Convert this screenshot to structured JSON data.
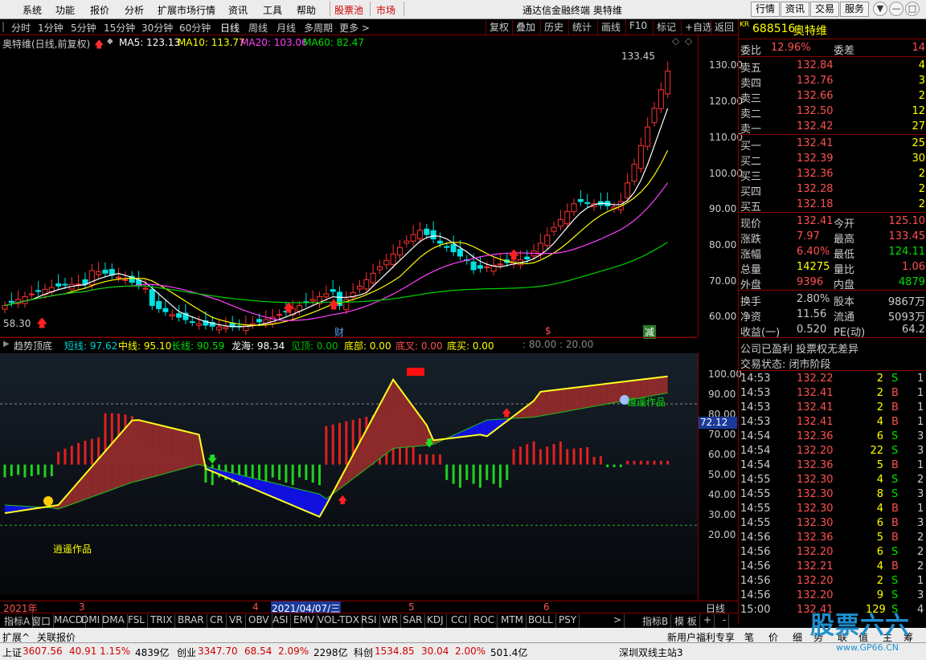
{
  "menubar": {
    "items": [
      "系统",
      "功能",
      "报价",
      "分析",
      "扩展市场行情",
      "资讯",
      "工具",
      "帮助",
      "股票池",
      "市场"
    ],
    "title": "通达信金融终端  奥特维",
    "right_buttons": [
      "行情",
      "资讯",
      "交易",
      "服务"
    ],
    "win_icons": [
      "▼",
      "—",
      "□",
      "✕"
    ]
  },
  "period": {
    "items": [
      "分时",
      "1分钟",
      "5分钟",
      "15分钟",
      "30分钟",
      "60分钟",
      "日线",
      "周线",
      "月线",
      "多周期",
      "更多 >"
    ],
    "active": "日线",
    "tools": [
      "复权",
      "叠加",
      "历史",
      "统计",
      "画线",
      "F10",
      "标记",
      "+自选",
      "返回"
    ]
  },
  "info": {
    "name": "奥特维(日线,前复权)",
    "ma5": "MA5: 123.13",
    "ma10": "MA10: 113.77",
    "ma20": "MA20: 103.06",
    "ma60": "MA60: 82.47",
    "high_label": "133.45",
    "low_label": "58.30"
  },
  "price_axis": [
    "130.00",
    "120.00",
    "110.00",
    "100.00",
    "90.00",
    "80.00",
    "70.00",
    "60.00"
  ],
  "markers": [
    "财",
    "$",
    "减"
  ],
  "indicator": {
    "name": "趋势顶底",
    "short": "短线: 97.62",
    "mid": "中线: 95.10",
    "long": "长线: 90.59",
    "longhai": "龙海: 98.34",
    "jd": "见顶: 0.00",
    "db": "底部: 0.00",
    "dc": "底叉: 0.00",
    "dm": "底买: 0.00",
    "lv": ": 80.00 : 20.00",
    "badge": "72.12",
    "axis": [
      "100.00",
      "90.00",
      "80.00",
      "70.00",
      "60.00",
      "50.00",
      "40.00",
      "30.00",
      "20.00"
    ],
    "wm1": "逍遥作品",
    "wm2": "逍遥作品"
  },
  "dates": {
    "year": "2021年",
    "m3": "3",
    "m4": "4",
    "sel": "2021/04/07/三",
    "m5": "5",
    "m6": "6",
    "period": "日线"
  },
  "quote": {
    "stock_code": "688516",
    "stock_name": "奥特维",
    "kr": "KR",
    "weibi_label": "委比",
    "weibi": "12.96%",
    "weicha_label": "委差",
    "weicha": "14",
    "asks": [
      {
        "l": "卖五",
        "p": "132.84",
        "v": "4"
      },
      {
        "l": "卖四",
        "p": "132.76",
        "v": "3"
      },
      {
        "l": "卖三",
        "p": "132.66",
        "v": "2"
      },
      {
        "l": "卖二",
        "p": "132.50",
        "v": "12"
      },
      {
        "l": "卖一",
        "p": "132.42",
        "v": "27"
      }
    ],
    "bids": [
      {
        "l": "买一",
        "p": "132.41",
        "v": "25"
      },
      {
        "l": "买二",
        "p": "132.39",
        "v": "30"
      },
      {
        "l": "买三",
        "p": "132.36",
        "v": "2"
      },
      {
        "l": "买四",
        "p": "132.28",
        "v": "2"
      },
      {
        "l": "买五",
        "p": "132.18",
        "v": "2"
      }
    ],
    "stats": [
      [
        "现价",
        "132.41",
        "今开",
        "125.10"
      ],
      [
        "涨跌",
        "7.97",
        "最高",
        "133.45"
      ],
      [
        "涨幅",
        "6.40%",
        "最低",
        "124.11"
      ],
      [
        "总量",
        "14275",
        "量比",
        "1.06"
      ],
      [
        "外盘",
        "9396",
        "内盘",
        "4879"
      ]
    ],
    "stats2": [
      [
        "换手",
        "2.80%",
        "股本",
        "9867万"
      ],
      [
        "净资",
        "11.56",
        "流通",
        "5093万"
      ],
      [
        "收益(一)",
        "0.520",
        "PE(动)",
        "64.2"
      ]
    ],
    "note1": "公司已盈利 投票权无差异",
    "note2": "交易状态: 闭市阶段",
    "ticks": [
      [
        "14:53",
        "132.22",
        "2",
        "S",
        "1"
      ],
      [
        "14:53",
        "132.41",
        "2",
        "B",
        "1"
      ],
      [
        "14:53",
        "132.41",
        "2",
        "B",
        "1"
      ],
      [
        "14:53",
        "132.41",
        "4",
        "B",
        "1"
      ],
      [
        "14:54",
        "132.36",
        "6",
        "S",
        "3"
      ],
      [
        "14:54",
        "132.20",
        "22",
        "S",
        "3"
      ],
      [
        "14:54",
        "132.36",
        "5",
        "B",
        "1"
      ],
      [
        "14:55",
        "132.30",
        "4",
        "S",
        "2"
      ],
      [
        "14:55",
        "132.30",
        "8",
        "S",
        "3"
      ],
      [
        "14:55",
        "132.30",
        "4",
        "B",
        "1"
      ],
      [
        "14:55",
        "132.30",
        "6",
        "B",
        "3"
      ],
      [
        "14:56",
        "132.36",
        "5",
        "B",
        "2"
      ],
      [
        "14:56",
        "132.20",
        "6",
        "S",
        "2"
      ],
      [
        "14:56",
        "132.21",
        "4",
        "B",
        "2"
      ],
      [
        "14:56",
        "132.20",
        "2",
        "S",
        "1"
      ],
      [
        "14:56",
        "132.20",
        "9",
        "S",
        "3"
      ],
      [
        "15:00",
        "132.41",
        "129",
        "S",
        "4"
      ]
    ]
  },
  "tabs": [
    "指标A",
    "窗口",
    "MACD",
    "DMI",
    "DMA",
    "FSL",
    "TRIX",
    "BRAR",
    "CR",
    "VR",
    "OBV",
    "ASI",
    "EMV",
    "VOL-TDX",
    "RSI",
    "WR",
    "SAR",
    "KDJ",
    "CCI",
    "ROC",
    "MTM",
    "BOLL",
    "PSY",
    ">",
    "指标B",
    "模 板",
    "+",
    "-"
  ],
  "extbar": {
    "a": "扩展^",
    "b": "关联报价",
    "c": "新用户福利专享",
    "d": "笔",
    "e": "价",
    "f": "细",
    "g": "势",
    "h": "联",
    "i": "值",
    "j": "主",
    "k": "筹"
  },
  "status": {
    "sh_l": "上证",
    "sh_p": "3607.56",
    "sh_c": "40.91",
    "sh_pct": "1.15%",
    "sh_v": "4839亿",
    "cy_l": "创业",
    "cy_p": "3347.70",
    "cy_c": "68.54",
    "cy_pct": "2.09%",
    "cy_v": "2298亿",
    "kc_l": "科创",
    "kc_p": "1534.85",
    "kc_c": "30.04",
    "kc_pct": "2.00%",
    "kc_v": "501.4亿",
    "srv": "深圳双线主站3"
  },
  "logo": {
    "text": "股票六六",
    "url": "www.GP66.CN"
  }
}
